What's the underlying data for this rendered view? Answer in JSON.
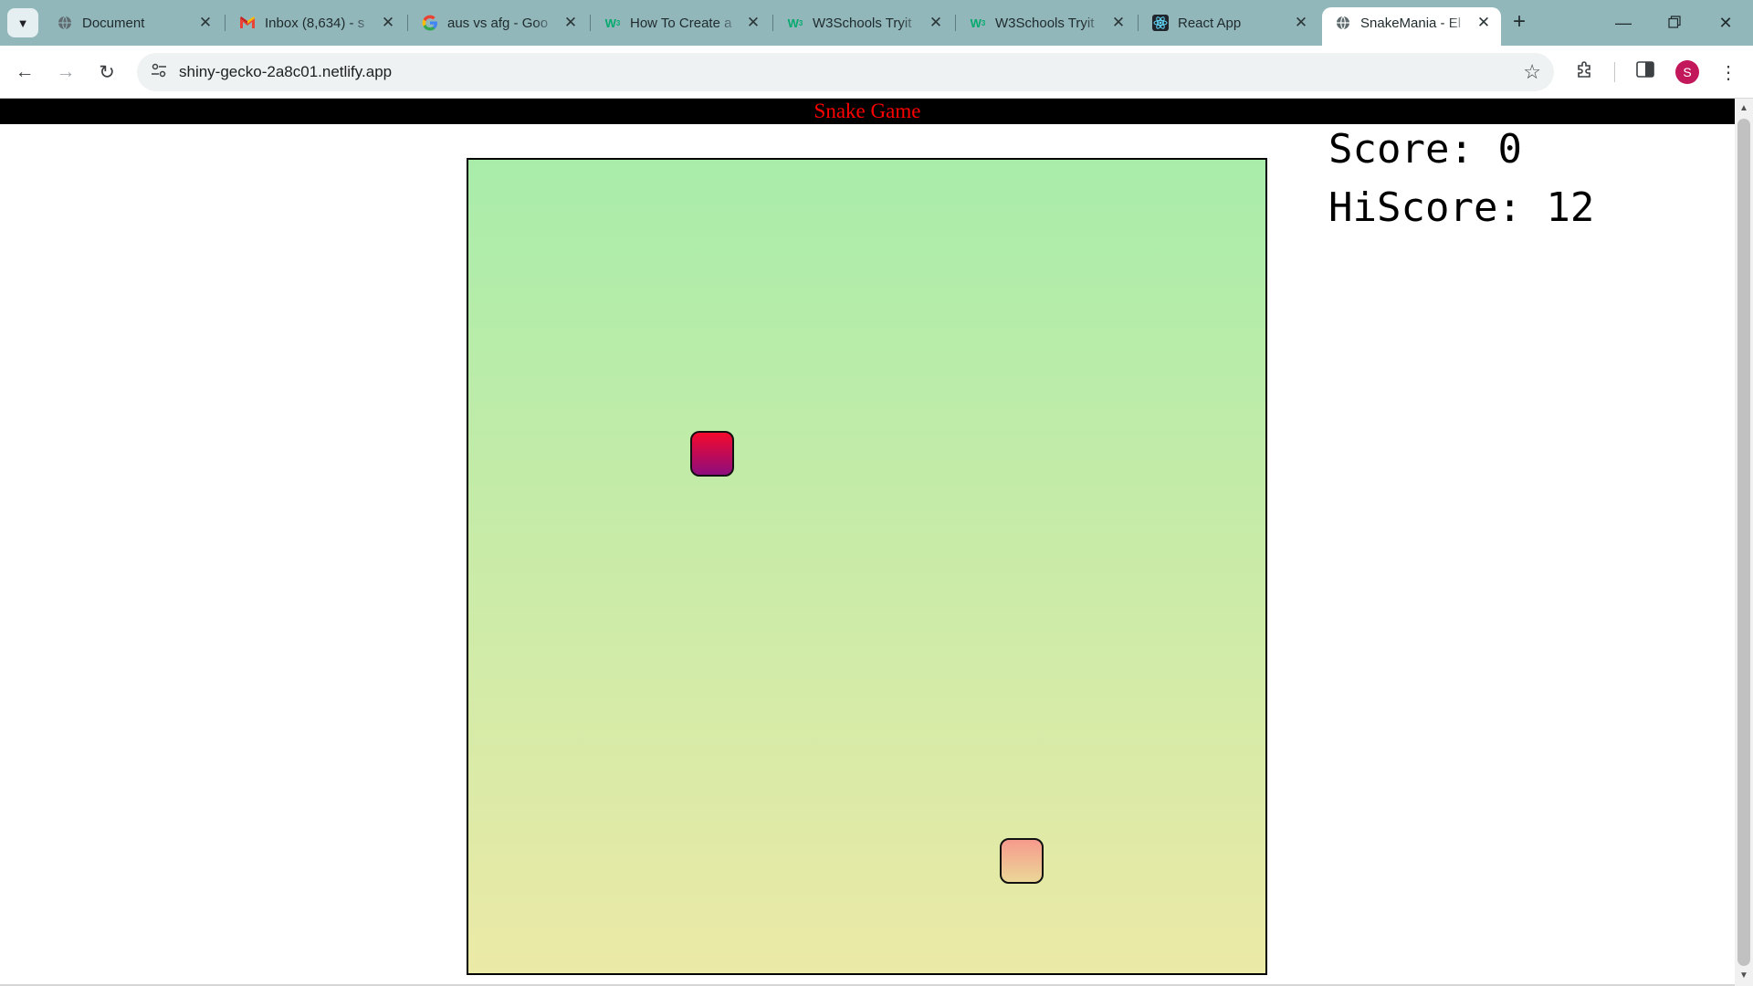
{
  "browser": {
    "tabs": [
      {
        "title": "Document",
        "favicon": "globe-icon"
      },
      {
        "title": "Inbox (8,634) - s",
        "favicon": "gmail-icon"
      },
      {
        "title": "aus vs afg - Goo",
        "favicon": "google-icon"
      },
      {
        "title": "How To Create a",
        "favicon": "w3schools-icon"
      },
      {
        "title": "W3Schools Tryit",
        "favicon": "w3schools-icon"
      },
      {
        "title": "W3Schools Tryit",
        "favicon": "w3schools-icon"
      },
      {
        "title": "React App",
        "favicon": "react-icon"
      },
      {
        "title": "SnakeMania - El",
        "favicon": "globe-icon",
        "active": true
      }
    ],
    "url": "shiny-gecko-2a8c01.netlify.app",
    "profile_initial": "S",
    "colors": {
      "tabstrip": "#92b7bb",
      "profile": "#c2185b"
    }
  },
  "page": {
    "header_title": "Snake Game",
    "score_label": "Score: ",
    "score": "0",
    "hiscore_label": "HiScore: ",
    "hiscore": "12",
    "colors": {
      "header_bg": "#000000",
      "header_text": "#ff0000",
      "board_top": "#a9ecaa",
      "board_bottom": "#ebeaa6",
      "snake_head": [
        "#f40a2c",
        "#8e0c7e"
      ],
      "food": [
        "#f79a8d",
        "#ebd797"
      ]
    }
  }
}
